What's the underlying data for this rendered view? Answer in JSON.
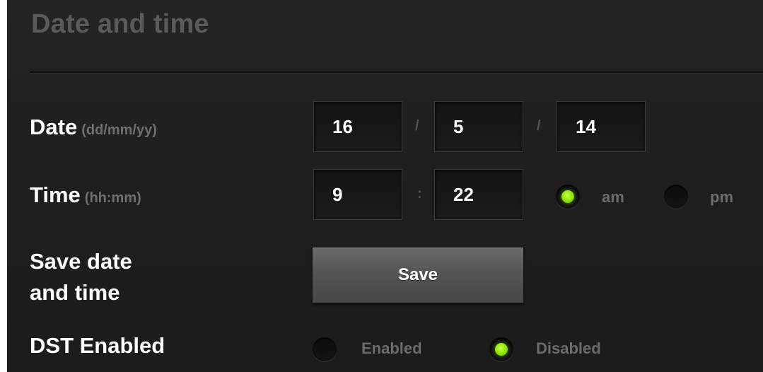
{
  "section": {
    "title": "Date and time"
  },
  "date": {
    "label": "Date",
    "hint": "(dd/mm/yy)",
    "day": "16",
    "month": "5",
    "year": "14",
    "separator": "/"
  },
  "time": {
    "label": "Time",
    "hint": "(hh:mm)",
    "hours": "9",
    "minutes": "22",
    "separator": ":",
    "am_label": "am",
    "pm_label": "pm",
    "period_selected": "am"
  },
  "save": {
    "label_line1": "Save date",
    "label_line2": "and time",
    "button_label": "Save"
  },
  "dst": {
    "label": "DST Enabled",
    "enabled_label": "Enabled",
    "disabled_label": "Disabled",
    "selected": "Disabled"
  },
  "colors": {
    "background": "#1f1f1f",
    "radio_selected": "#8ae400",
    "title_text": "#5a5a5a",
    "hint_text": "#6f6f6f"
  }
}
